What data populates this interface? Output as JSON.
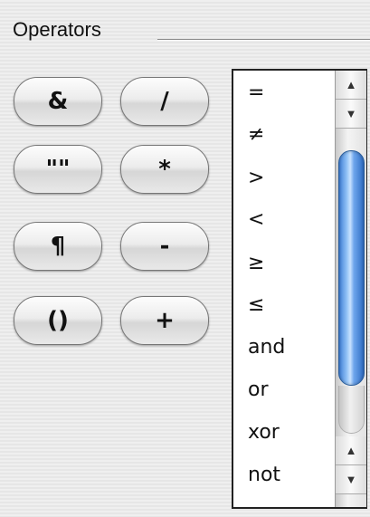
{
  "section": {
    "title": "Operators"
  },
  "buttons": [
    {
      "label": "&",
      "name": "ampersand-button"
    },
    {
      "label": "/",
      "name": "divide-button"
    },
    {
      "label": "\"\"",
      "name": "quotes-button"
    },
    {
      "label": "*",
      "name": "multiply-button"
    },
    {
      "label": "¶",
      "name": "pilcrow-button"
    },
    {
      "label": "-",
      "name": "minus-button"
    },
    {
      "label": "()",
      "name": "parentheses-button"
    },
    {
      "label": "+",
      "name": "plus-button"
    }
  ],
  "operators_list": {
    "items": [
      "=",
      "≠",
      ">",
      "<",
      "≥",
      "≤",
      "and",
      "or",
      "xor",
      "not"
    ]
  },
  "scrollbar": {
    "up_arrow": "▲",
    "down_arrow": "▼"
  }
}
